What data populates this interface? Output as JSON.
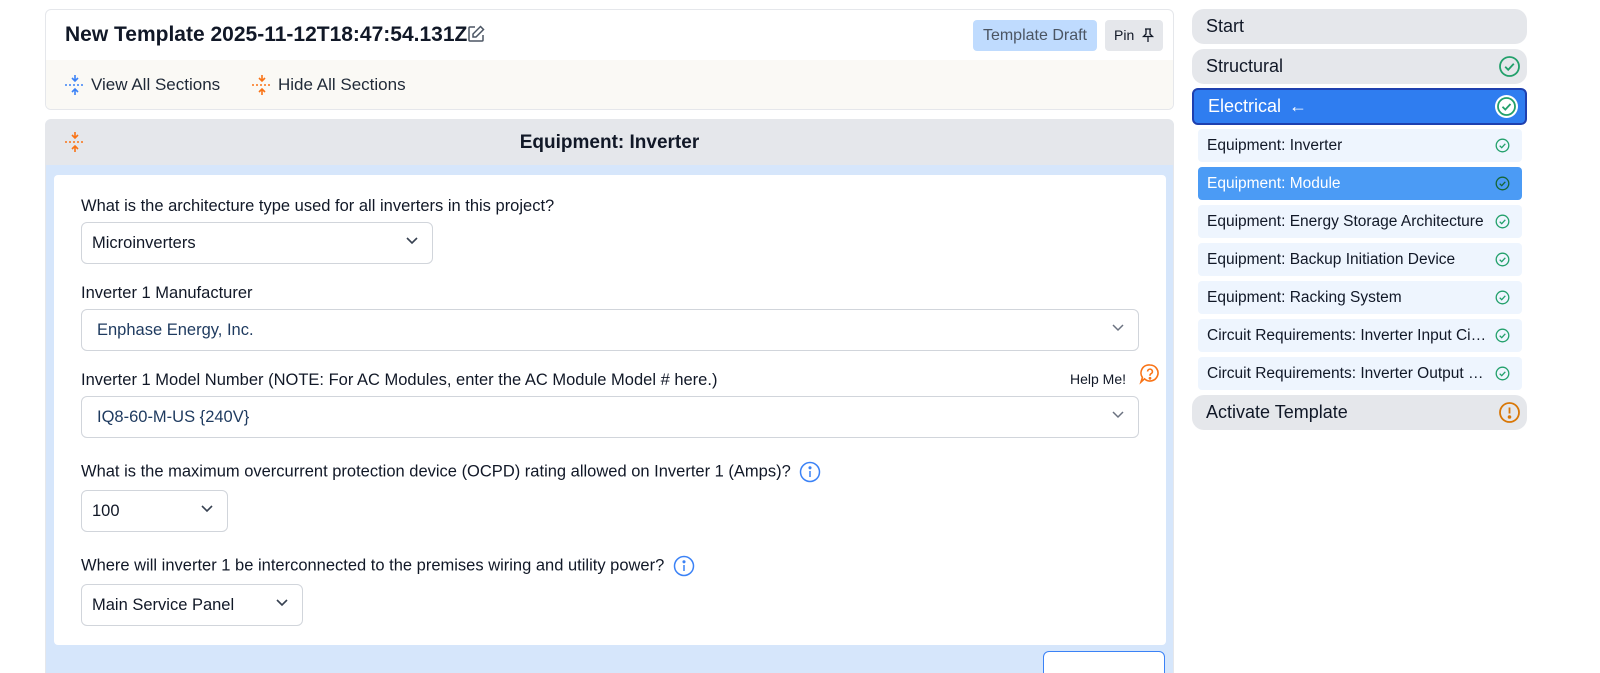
{
  "header": {
    "title": "New Template 2025-11-12T18:47:54.131Z",
    "badge": "Template Draft",
    "pin_label": "Pin",
    "view_all_label": "View All Sections",
    "hide_all_label": "Hide All Sections"
  },
  "section": {
    "title": "Equipment: Inverter",
    "questions": {
      "architecture": {
        "label": "What is the architecture type used for all inverters in this project?",
        "value": "Microinverters"
      },
      "manufacturer": {
        "label": "Inverter 1 Manufacturer",
        "value": "Enphase Energy, Inc."
      },
      "model": {
        "label": "Inverter 1 Model Number (NOTE: For AC Modules, enter the AC Module Model # here.)",
        "value": "IQ8-60-M-US {240V}",
        "help_label": "Help Me!"
      },
      "ocpd": {
        "label": "What is the maximum overcurrent protection device (OCPD) rating allowed on Inverter 1 (Amps)?",
        "value": "100"
      },
      "interconnection": {
        "label": "Where will inverter 1 be interconnected to the premises wiring and utility power?",
        "value": "Main Service Panel"
      }
    }
  },
  "nav": {
    "steps": {
      "start": {
        "label": "Start"
      },
      "structural": {
        "label": "Structural",
        "status": "complete"
      },
      "electrical": {
        "label": "Electrical",
        "arrow": "←",
        "status": "complete"
      },
      "activate": {
        "label": "Activate Template",
        "status": "warning"
      }
    },
    "electrical_items": [
      {
        "label": "Equipment: Inverter"
      },
      {
        "label": "Equipment: Module"
      },
      {
        "label": "Equipment: Energy Storage Architecture"
      },
      {
        "label": "Equipment: Backup Initiation Device"
      },
      {
        "label": "Equipment: Racking System"
      },
      {
        "label": "Circuit Requirements: Inverter Input Circuit"
      },
      {
        "label": "Circuit Requirements: Inverter Output Circuit"
      }
    ]
  },
  "colors": {
    "accent_blue": "#2f7df0",
    "selected_item": "#4b9bf5",
    "success_green": "#22a06b",
    "warning_orange": "#d97706",
    "collapse_orange": "#f97316"
  }
}
